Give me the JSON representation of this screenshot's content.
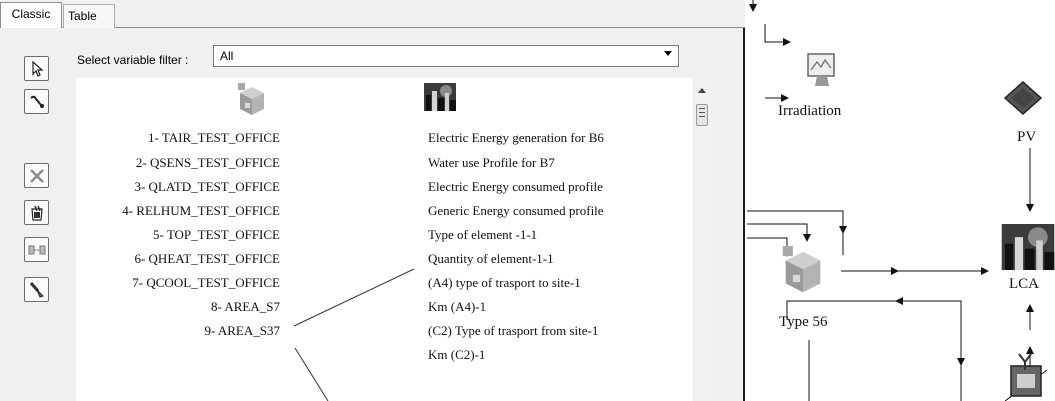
{
  "tabs": [
    {
      "label": "Classic"
    },
    {
      "label": "Table"
    }
  ],
  "filter": {
    "label": "Select variable filter :",
    "value": "All"
  },
  "toolbar": {
    "icons": [
      "select-arrow-icon",
      "connect-tool-icon",
      "delete-link-icon",
      "erase-bucket-icon",
      "link-style-icon",
      "paint-brush-icon"
    ]
  },
  "outputs": [
    "1- TAIR_TEST_OFFICE",
    "2- QSENS_TEST_OFFICE",
    "3- QLATD_TEST_OFFICE",
    "4- RELHUM_TEST_OFFICE",
    "5- TOP_TEST_OFFICE",
    "6- QHEAT_TEST_OFFICE",
    "7- QCOOL_TEST_OFFICE",
    "8- AREA_S7",
    "9- AREA_S37"
  ],
  "inputs": [
    "Electric Energy generation for B6",
    "Water use Profile for B7",
    "Electric Energy consumed profile",
    "Generic Energy consumed profile",
    "Type of element -1-1",
    "Quantity of element-1-1",
    "(A4) type of trasport to site-1",
    "Km (A4)-1",
    "(C2) Type of trasport from site-1",
    "Km (C2)-1"
  ],
  "components": {
    "irradiation": "Irradiation",
    "pv": "PV",
    "type56": "Type 56",
    "lca": "LCA"
  }
}
